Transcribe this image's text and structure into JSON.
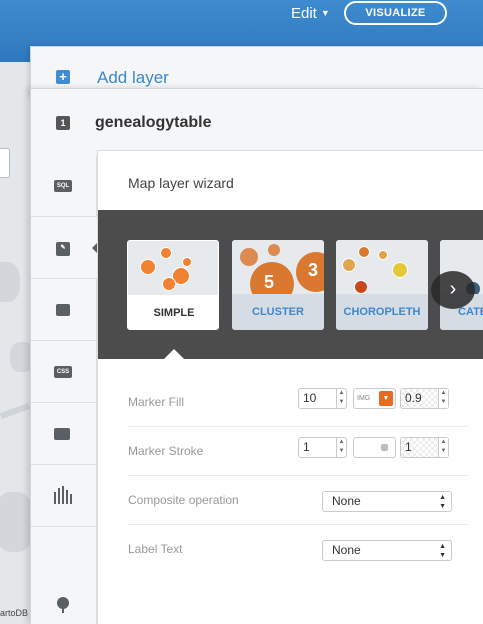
{
  "topbar": {
    "edit_label": "Edit",
    "visualize_label": "VISUALIZE",
    "accent": "#3b86cc"
  },
  "map": {
    "attribution": "artoDB"
  },
  "add_layer": {
    "icon": "+",
    "label": "Add layer"
  },
  "layer": {
    "number": "1",
    "name": "genealogytable"
  },
  "toolbar": [
    {
      "name": "sql-tool",
      "icon": "SQL"
    },
    {
      "name": "wizard-tool",
      "icon": "brush"
    },
    {
      "name": "infowindow-tool",
      "icon": "speech-bubble"
    },
    {
      "name": "css-tool",
      "icon": "CSS"
    },
    {
      "name": "legend-tool",
      "icon": "legend"
    },
    {
      "name": "filters-tool",
      "icon": "bar-chart"
    },
    {
      "name": "add-tool",
      "icon": "marker-plus"
    }
  ],
  "wizard": {
    "title": "Map layer wizard",
    "cards": [
      {
        "label": "SIMPLE",
        "active": true
      },
      {
        "label": "CLUSTER",
        "active": false,
        "numbers": [
          "5",
          "3"
        ]
      },
      {
        "label": "CHOROPLETH",
        "active": false
      },
      {
        "label": "CATE",
        "active": false
      }
    ],
    "next_icon": "chevron-right-icon",
    "colors": {
      "marker": "#f08232",
      "strip": "#4c4c4c"
    }
  },
  "properties": {
    "marker_fill": {
      "label": "Marker Fill",
      "size": "10",
      "img": "IMG",
      "opacity": "0.9",
      "color": "#e86b21"
    },
    "marker_stroke": {
      "label": "Marker Stroke",
      "width": "1",
      "opacity": "1"
    },
    "composite": {
      "label": "Composite operation",
      "value": "None"
    },
    "label_text": {
      "label": "Label Text",
      "value": "None"
    }
  }
}
